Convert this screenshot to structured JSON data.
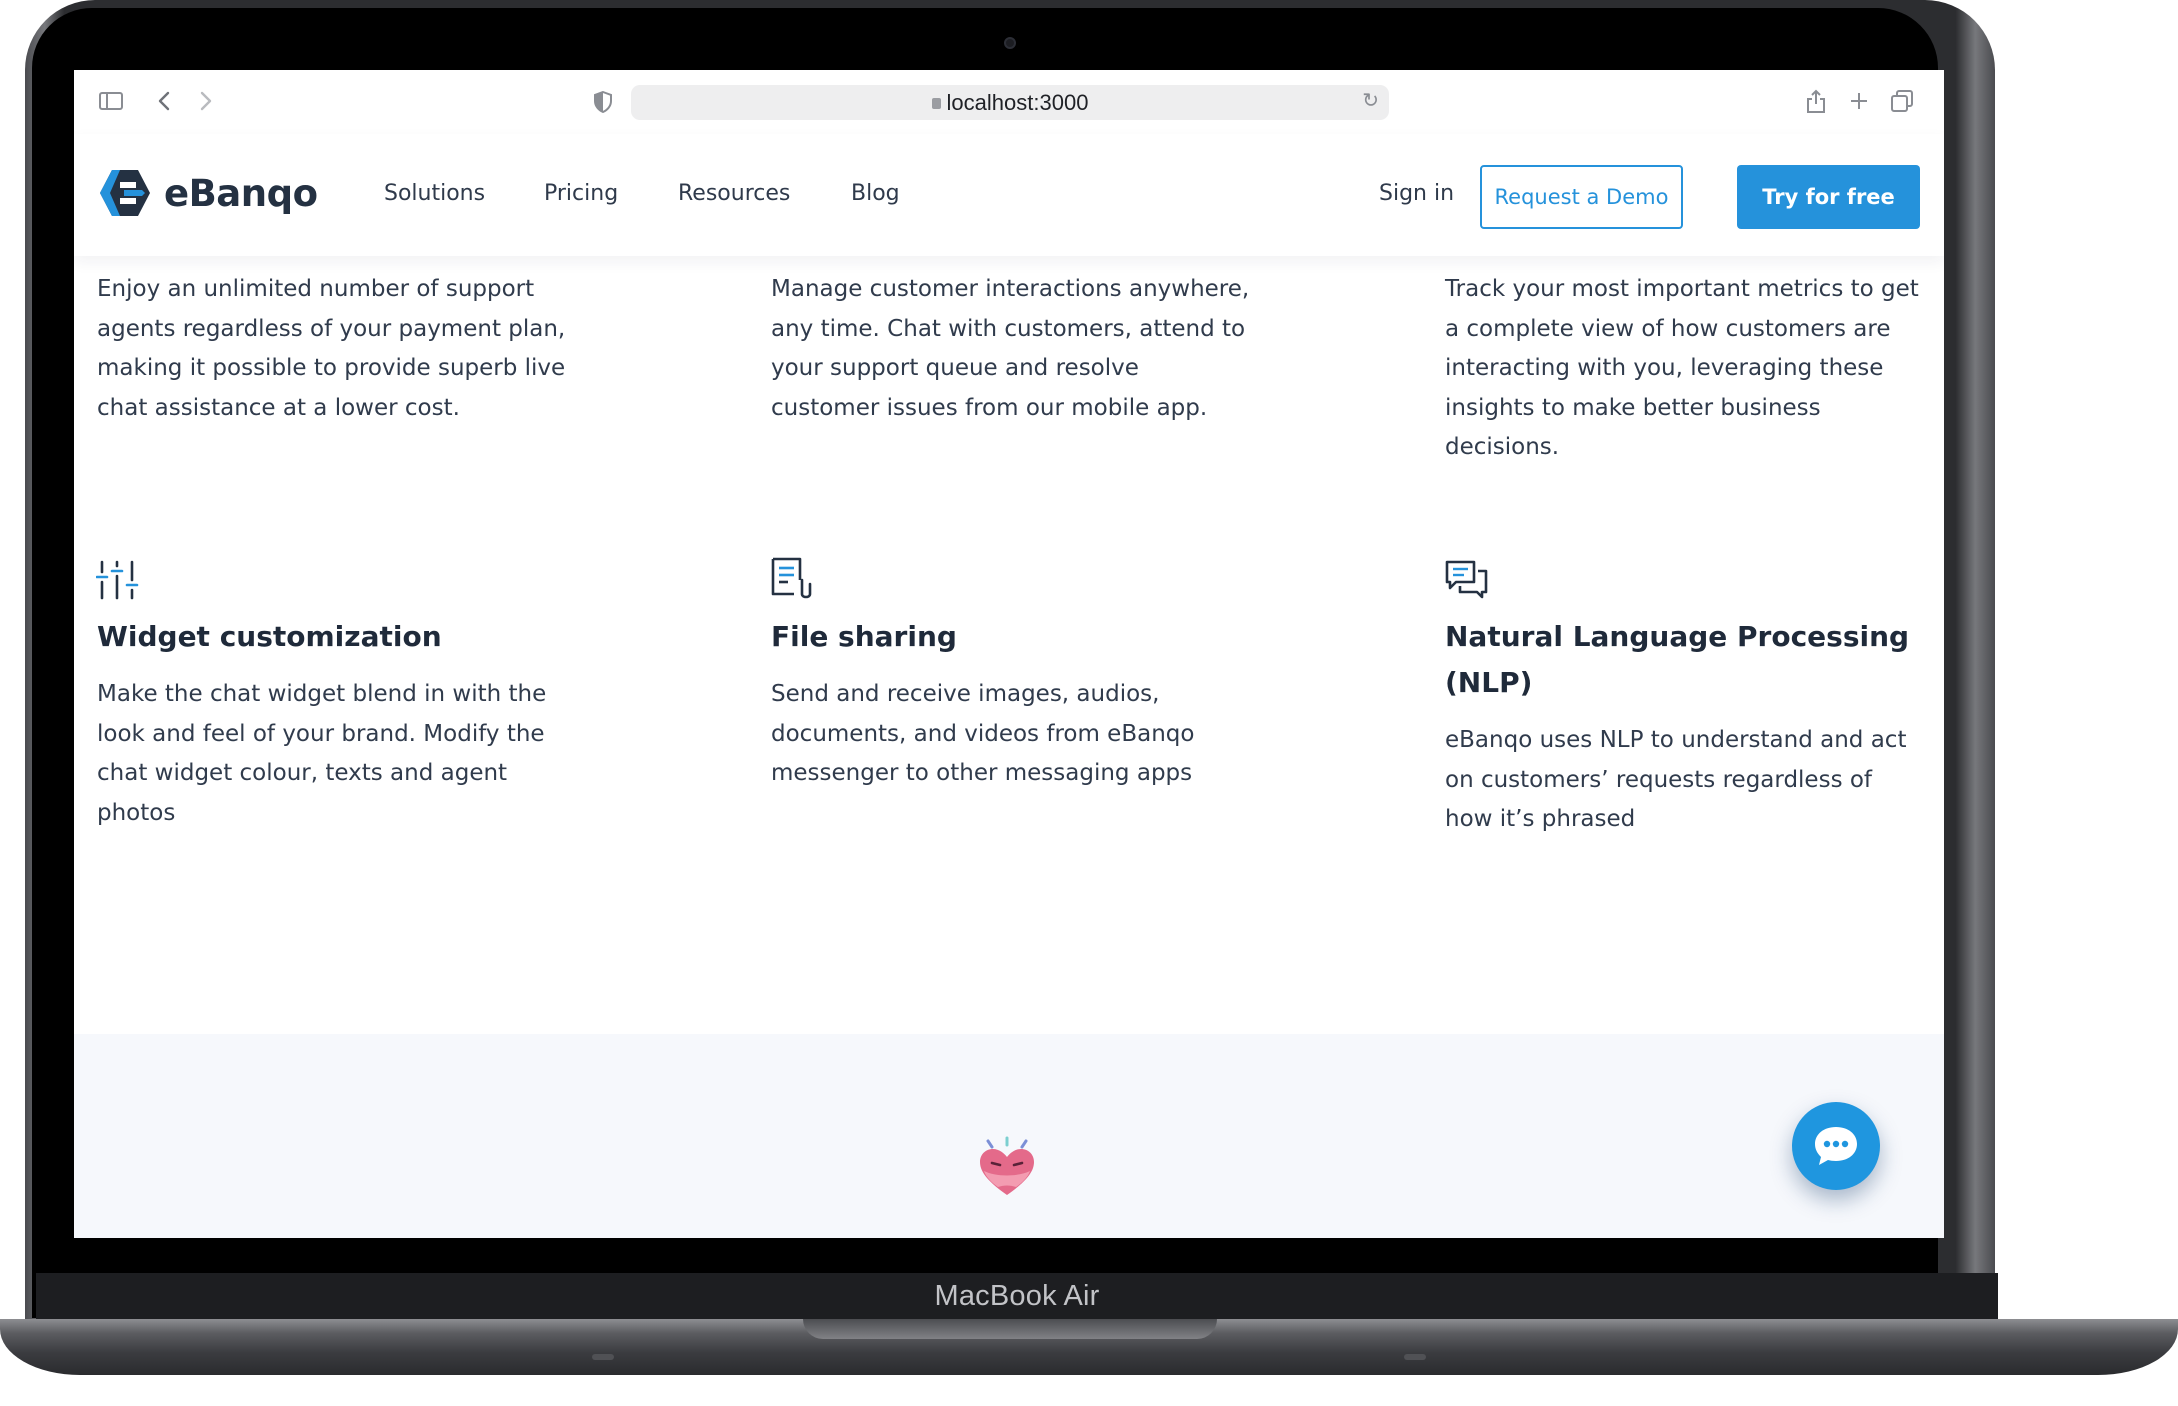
{
  "device": {
    "label": "MacBook Air"
  },
  "browser": {
    "url": "localhost:3000"
  },
  "header": {
    "brand": "eBanqo",
    "nav": [
      {
        "label": "Solutions"
      },
      {
        "label": "Pricing"
      },
      {
        "label": "Resources"
      },
      {
        "label": "Blog"
      }
    ],
    "signin": "Sign in",
    "demo_button": "Request a Demo",
    "try_button": "Try for free"
  },
  "features_top": [
    {
      "text": "Enjoy an unlimited number of support agents regardless of your payment plan, making it possible to provide superb live chat assistance at a lower cost."
    },
    {
      "text": "Manage customer interactions anywhere, any time. Chat with customers, attend to your support queue and resolve customer issues from our mobile app."
    },
    {
      "text": "Track your most important metrics to get a complete view of how customers are interacting with you, leveraging these insights to make better business decisions."
    }
  ],
  "features": [
    {
      "icon": "sliders-icon",
      "title": "Widget customization",
      "text": "Make the chat widget blend in with the look and feel of your brand. Modify the chat widget colour, texts and agent photos"
    },
    {
      "icon": "file-attachment-icon",
      "title": "File sharing",
      "text": "Send and receive images, audios, documents, and videos from eBanqo messenger to other messaging apps"
    },
    {
      "icon": "chat-bubbles-icon",
      "title": "Natural Language Processing (NLP)",
      "text": "eBanqo uses NLP to understand and act on customers’ requests regardless of how it’s phrased"
    }
  ],
  "colors": {
    "brand_blue": "#2592db",
    "text_dark": "#1f2a3a",
    "footer_bg": "#f6f8fc"
  }
}
